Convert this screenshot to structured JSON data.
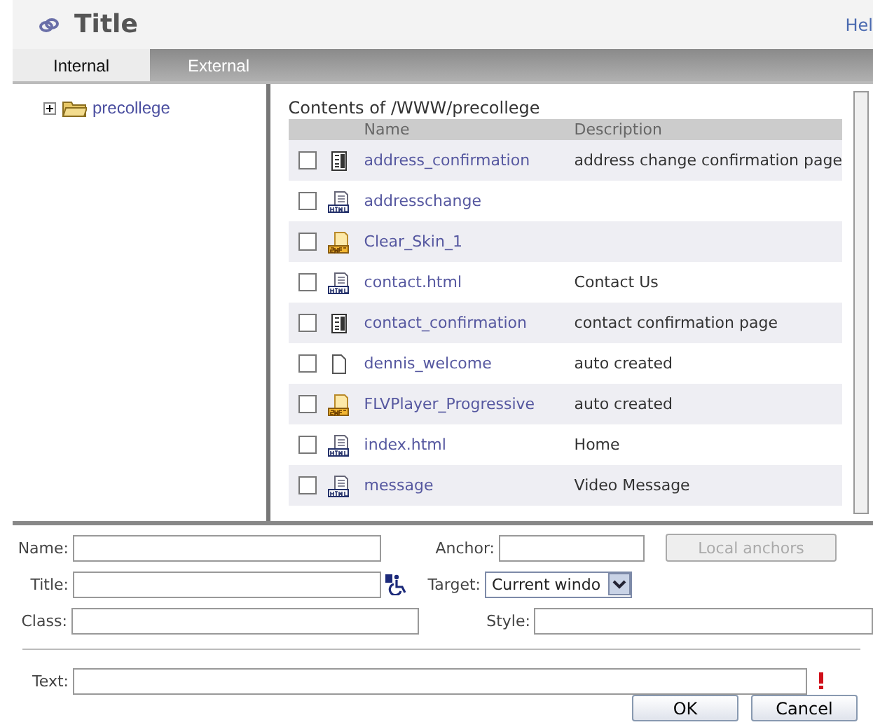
{
  "header": {
    "title": "Title",
    "help_link": "Hel"
  },
  "tabs": [
    {
      "label": "Internal",
      "selected": true
    },
    {
      "label": "External",
      "selected": false
    }
  ],
  "tree": [
    {
      "label": "precollege",
      "expanded": false
    }
  ],
  "contents": {
    "heading": "Contents of /WWW/precollege",
    "columns": [
      "Name",
      "Description"
    ],
    "rows": [
      {
        "kind": "page",
        "name": "address_confirmation",
        "description": "address change confirmation page",
        "checked": false
      },
      {
        "kind": "html",
        "name": "addresschange",
        "checked": false
      },
      {
        "kind": "swf",
        "name": "Clear_Skin_1",
        "checked": false
      },
      {
        "kind": "html",
        "name": "contact.html",
        "description": "Contact Us",
        "checked": false
      },
      {
        "kind": "page",
        "name": "contact_confirmation",
        "description": "contact confirmation page",
        "checked": false
      },
      {
        "kind": "blank",
        "name": "dennis_welcome",
        "description": "auto created",
        "checked": false
      },
      {
        "kind": "swf",
        "name": "FLVPlayer_Progressive",
        "description": "auto created",
        "checked": false
      },
      {
        "kind": "html",
        "name": "index.html",
        "description": "Home",
        "checked": false
      },
      {
        "kind": "html",
        "name": "message",
        "description": "Video Message",
        "checked": false
      }
    ]
  },
  "form": {
    "name_label": "Name:",
    "title_label": "Title:",
    "class_label": "Class:",
    "anchor_label": "Anchor:",
    "local_anchors_button": "Local anchors",
    "target_label": "Target:",
    "target_value": "Current windo",
    "style_label": "Style:",
    "text_label": "Text:",
    "ok_button": "OK",
    "cancel_button": "Cancel"
  }
}
